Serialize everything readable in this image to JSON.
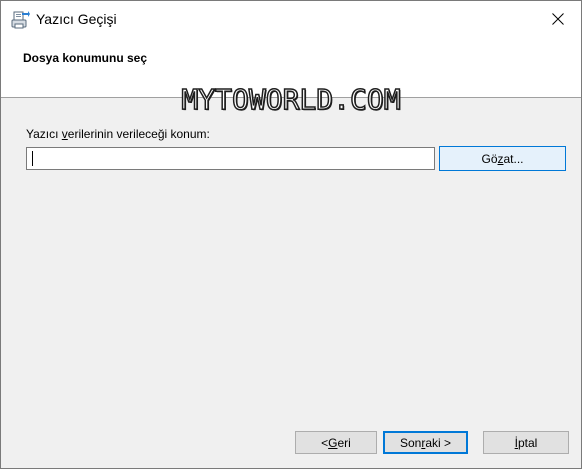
{
  "window": {
    "title": "Yazıcı Geçişi",
    "close_icon": "close-icon",
    "app_icon": "printer-migration-icon"
  },
  "header": {
    "title": "Dosya konumunu seç"
  },
  "watermark": {
    "text": "MYTOWORLD.COM"
  },
  "form": {
    "label_pre": "Yazıcı ",
    "label_accel": "v",
    "label_post": "erilerinin verileceği konum:",
    "path_value": "",
    "browse_pre": "Gö",
    "browse_accel": "z",
    "browse_post": "at..."
  },
  "footer": {
    "back_pre": "< ",
    "back_accel": "G",
    "back_post": "eri",
    "next_pre": "Son",
    "next_accel": "r",
    "next_post": "aki >",
    "cancel_accel": "İ",
    "cancel_post": "ptal"
  },
  "colors": {
    "accent": "#0078d7",
    "header_bg": "#ffffff",
    "body_bg": "#f0f0f0"
  }
}
